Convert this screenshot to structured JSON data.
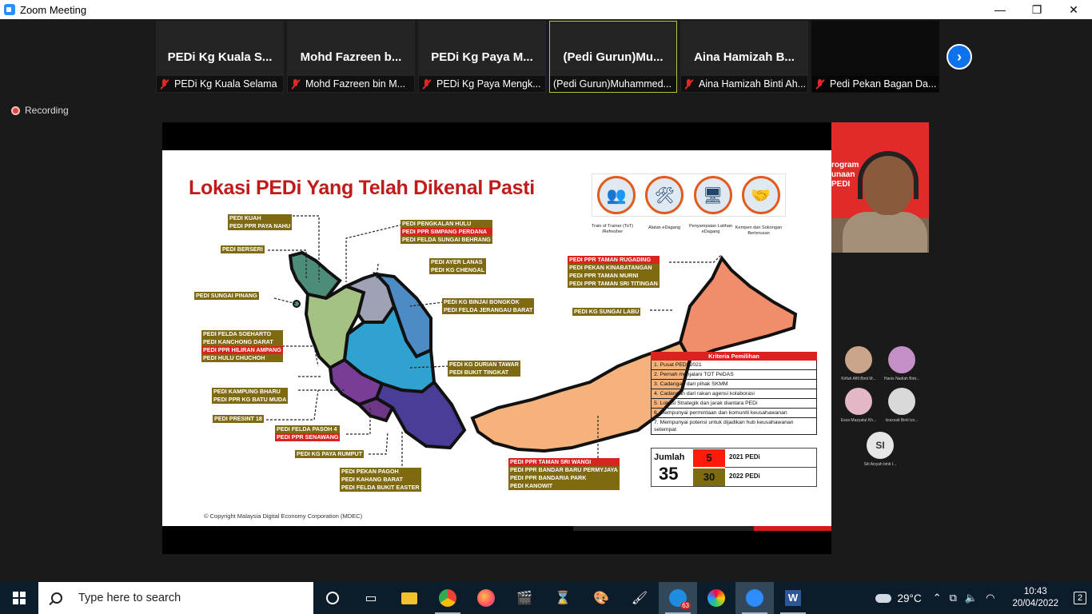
{
  "window": {
    "title": "Zoom Meeting",
    "minimize": "—",
    "maximize": "❐",
    "close": "✕"
  },
  "participants": [
    {
      "display": "PEDi Kg Kuala S...",
      "label": "PEDi Kg Kuala Selama"
    },
    {
      "display": "Mohd Fazreen b...",
      "label": "Mohd Fazreen bin M..."
    },
    {
      "display": "PEDi Kg Paya M...",
      "label": "PEDi Kg Paya Mengk..."
    },
    {
      "display": "(Pedi Gurun)Mu...",
      "label": "(Pedi Gurun)Muhammed..."
    },
    {
      "display": "Aina Hamizah B...",
      "label": "Aina Hamizah Binti Ah..."
    },
    {
      "display": "",
      "label": "Pedi Pekan Bagan Da..."
    }
  ],
  "recording_label": "Recording",
  "slide": {
    "title": "Lokasi PEDi Yang Telah Dikenal Pasti",
    "copyright": "© Copyright Malaysia Digital Economy Corporation (MDEC)",
    "icon_captions": [
      "Train of Trainer (ToT) /Refresher",
      "Alatan eDagang",
      "Penyampaian Latihan eDagang",
      "Kempen dan Sokongan Berterusan"
    ],
    "kriteria_title": "Kriteria Pemilihan",
    "kriteria": [
      "1. Pusat PEDI 2021",
      "2. Pernah menjalani TOT PeDAS",
      "3. Cadangan dari pihak SKMM",
      "4. Cadangan dari rakan agensi kolaborasi",
      "5. Lokasi Strategik dan jarak diantara PEDi",
      "6. Mempunyai permintaan dan komuniti keusahawanan",
      "7. Mempunyai potensi untuk dijadikan hub keusahawanan setempat"
    ],
    "jumlah_label": "Jumlah",
    "jumlah_total": "35",
    "count_2021": "5",
    "label_2021": "2021 PEDi",
    "count_2022": "30",
    "label_2022": "2022 PEDi"
  },
  "speaker_bg_text": "rogram\nunaan\nPEDI",
  "gallery": [
    {
      "name": "Kirfah Afifi Binti M...",
      "initials": ""
    },
    {
      "name": "Hanis Nadiah Bint...",
      "initials": ""
    },
    {
      "name": "Esza Mazyatul Kh...",
      "initials": ""
    },
    {
      "name": "Izuizzati Binti Izz...",
      "initials": ""
    },
    {
      "name": "Siti Aisyah binti I...",
      "initials": "SI"
    }
  ],
  "taskbar": {
    "search_placeholder": "Type here to search",
    "temperature": "29°C",
    "time": "10:43",
    "date": "20/04/2022",
    "notifications": "2",
    "mail_badge": "63"
  }
}
